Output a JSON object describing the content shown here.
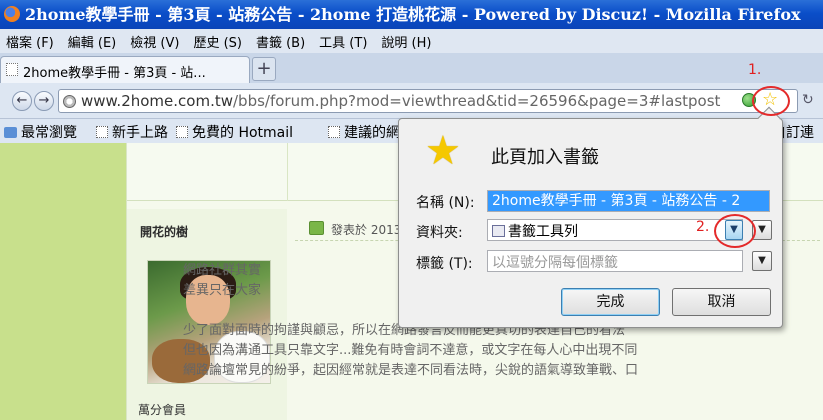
{
  "window": {
    "title": "2home教學手冊 - 第3頁 - 站務公告 - 2home 打造桃花源 - Powered by Discuz! - Mozilla Firefox"
  },
  "menu": [
    "檔案 (F)",
    "編輯 (E)",
    "檢視 (V)",
    "歷史 (S)",
    "書籤 (B)",
    "工具 (T)",
    "說明 (H)"
  ],
  "tab": {
    "label": "2home教學手冊 - 第3頁 - 站...",
    "new_tab": "+"
  },
  "nav": {
    "back": "←",
    "forward": "→",
    "url_domain": "www.2home.com.tw",
    "url_path": "/bbs/forum.php?mod=viewthread&tid=26596&page=3#lastpost",
    "star": "☆",
    "reload": "↻"
  },
  "bookmarks": {
    "items": [
      "最常瀏覽",
      "新手上路",
      "免費的 Hotmail",
      "建議的網"
    ],
    "right_item": "自訂連"
  },
  "post": {
    "author": "開花的樹",
    "rank": "萬分會員",
    "date_prefix": "發表於 2013",
    "lines": [
      "網路社群其實",
      "差異只在大家",
      "",
      "少了面對面時的拘謹與顧忌，所以在網路發言反而能更真切的表達自己的看法",
      "但也因為溝通工具只靠文字...難免有時會詞不達意，或文字在每人心中出現不同",
      "網路論壇常見的紛爭，起因經常就是表達不同看法時，尖銳的語氣導致筆戰、口"
    ]
  },
  "dialog": {
    "title": "此頁加入書籤",
    "name_label": "名稱 (N):",
    "name_value": "2home教學手冊 - 第3頁 - 站務公告 - 2",
    "folder_label": "資料夾:",
    "folder_value": "書籤工具列",
    "tags_label": "標籤 (T):",
    "tags_placeholder": "以逗號分隔每個標籤",
    "done_label": "完成",
    "cancel_label": "取消"
  },
  "annotations": {
    "step1": "1.",
    "step2": "2."
  },
  "colors": {
    "titlebar": "#0a4ec9",
    "annotation": "#e02020",
    "page_bg": "#c8e08c",
    "selection": "#3399ff"
  }
}
